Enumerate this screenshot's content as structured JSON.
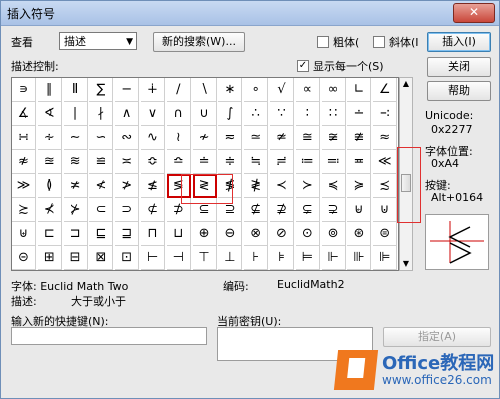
{
  "window": {
    "title": "插入符号",
    "close_glyph": "✕"
  },
  "toolbar": {
    "view_label": "查看",
    "view_value": "描述",
    "new_search_label": "新的搜索(W)...",
    "bold_label": "粗体(",
    "italic_label": "斜体(I",
    "insert_label": "插入(I)"
  },
  "grid_label": "描述控制:",
  "show_each_once_label": "显示每一个(S)",
  "close_label": "关闭",
  "help_label": "帮助",
  "info": {
    "unicode_label": "Unicode:",
    "unicode_value": "0x2277",
    "font_pos_label": "字体位置:",
    "font_pos_value": "0xA4",
    "key_label": "按键:",
    "key_value": "Alt+0164"
  },
  "symbols": [
    [
      "∍",
      "∥",
      "Ⅱ",
      "∑",
      "−",
      "∔",
      "∕",
      "∖",
      "∗",
      "∘",
      "√",
      "∝",
      "∞",
      "∟",
      "∠"
    ],
    [
      "∡",
      "∢",
      "∣",
      "∤",
      "∧",
      "∨",
      "∩",
      "∪",
      "∫",
      "∴",
      "∵",
      "∶",
      "∷",
      "∸",
      "∹"
    ],
    [
      "∺",
      "∻",
      "∼",
      "∽",
      "∾",
      "∿",
      "≀",
      "≁",
      "≂",
      "≃",
      "≄",
      "≅",
      "≆",
      "≇",
      "≈"
    ],
    [
      "≉",
      "≊",
      "≋",
      "≌",
      "≍",
      "≎",
      "≏",
      "≐",
      "≑",
      "≒",
      "≓",
      "≔",
      "≕",
      "≖",
      "≪"
    ],
    [
      "≫",
      "≬",
      "≭",
      "≮",
      "≯",
      "≰",
      "≶",
      "≷",
      "≸",
      "≹",
      "≺",
      "≻",
      "≼",
      "≽",
      "≾"
    ],
    [
      "≿",
      "⊀",
      "⊁",
      "⊂",
      "⊃",
      "⊄",
      "⊅",
      "⊆",
      "⊇",
      "⊈",
      "⊉",
      "⊊",
      "⊋",
      "⊌",
      "⊍"
    ],
    [
      "⊎",
      "⊏",
      "⊐",
      "⊑",
      "⊒",
      "⊓",
      "⊔",
      "⊕",
      "⊖",
      "⊗",
      "⊘",
      "⊙",
      "⊚",
      "⊛",
      "⊜"
    ],
    [
      "⊝",
      "⊞",
      "⊟",
      "⊠",
      "⊡",
      "⊢",
      "⊣",
      "⊤",
      "⊥",
      "⊦",
      "⊧",
      "⊨",
      "⊩",
      "⊪",
      "⊫"
    ]
  ],
  "font_label": "字体: Euclid Math Two",
  "encoding_label": "编码:",
  "encoding_value": "EuclidMath2",
  "desc_label": "描述:",
  "desc_value": "大于或小于",
  "new_shortcut_label": "输入新的快捷键(N):",
  "current_key_label": "当前密钥(U):",
  "assign_label": "指定(A)",
  "logo": {
    "brand": "Office教程网",
    "url": "www.office26.com"
  }
}
